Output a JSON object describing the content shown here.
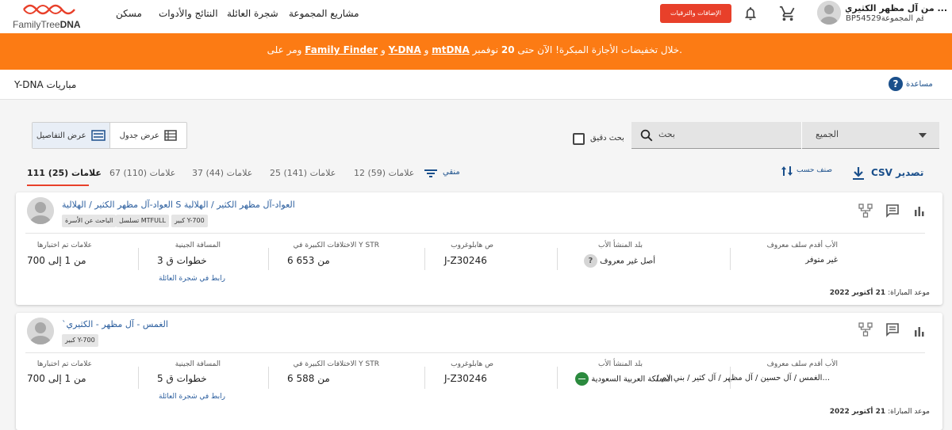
{
  "nav": {
    "logo_family": "Family",
    "logo_rest": "Tree",
    "logo_dna": "DNA",
    "links": [
      "مسكن",
      "النتائج والأدوات",
      "شجرة العائلة",
      "مشاريع المجموعة"
    ],
    "addons_button": "الإضافات والترقيات",
    "user_name": "... من آل مظهر الكثيري",
    "user_group": "BP54529رقم المجموعة"
  },
  "banner": {
    "prefix": "خلال تخفيضات الأجازة المبكرة! الآن حتى",
    "day": "20",
    "month": "نوفمبر",
    "products": [
      "mtDNA",
      "Y-DNA",
      "Family Finder"
    ],
    "joiner": "و",
    "suffix": "ومر على"
  },
  "page": {
    "title": "Y-DNA مباريات",
    "help": "مساعدة"
  },
  "view_toggle": {
    "details": "عرض التفاصيل",
    "table": "عرض جدول"
  },
  "search": {
    "dropdown_value": "الجميع",
    "placeholder": "بحث",
    "exact_label": "بحث دقيق"
  },
  "tabs": [
    {
      "count": "(25)",
      "label": "111 علامات"
    },
    {
      "count": "(110)",
      "label": "67 علامات"
    },
    {
      "count": "(44)",
      "label": "37 علامات"
    },
    {
      "count": "(141)",
      "label": "25 علامات"
    },
    {
      "count": "(59)",
      "label": "12 علامات"
    }
  ],
  "toolbar": {
    "filter": "منقي",
    "sort": "صنف حسب",
    "export": "CSV تصدير"
  },
  "labels": {
    "ancestor": "الأب أقدم سلف معروف",
    "origin": "بلد المنشأ الأب",
    "haplogroup": "ص هابلوغروب",
    "str_diff": "Y STR الاختلافات الكبيرة في",
    "genetic_distance": "المسافة الجينية",
    "markers_tested": "علامات تم اختبارها",
    "tree_link": "رابط في شجرة العائلة",
    "match_date": "موعد المباراة:"
  },
  "matches": [
    {
      "name": "العواد-آل مظهر الكثير / الهلالية S العواد-آل مظهر الكثير / الهلالية",
      "badges": [
        "Y-700 كبير",
        "MTFULL تسلسل",
        "الباحث عن الأسرة"
      ],
      "ancestor": "غير متوفر",
      "origin": "أصل غير معروف",
      "haplogroup": "J-Z30246",
      "str_diff": "من 653 6",
      "genetic_distance": "خطوات ق 3",
      "markers_tested": "من 1 إلى 700",
      "date": "21 أكتوبر 2022"
    },
    {
      "name": "الغمس - آل مظهر - الكثيري`",
      "badges": [
        "Y-700 كبير"
      ],
      "ancestor": "...الغمس / آل حسين / آل مظهر / آل كثير / بني لام /",
      "origin": "المملكة العربية السعودية",
      "haplogroup": "J-Z30246",
      "str_diff": "من 588 6",
      "genetic_distance": "خطوات ق 5",
      "markers_tested": "من 1 إلى 700",
      "date": "21 أكتوبر 2022"
    }
  ],
  "colors": {
    "brand_orange": "#fc7b14",
    "brand_red": "#e8402a",
    "link_blue": "#2b5e9e",
    "help_blue": "#1a4f8b"
  }
}
